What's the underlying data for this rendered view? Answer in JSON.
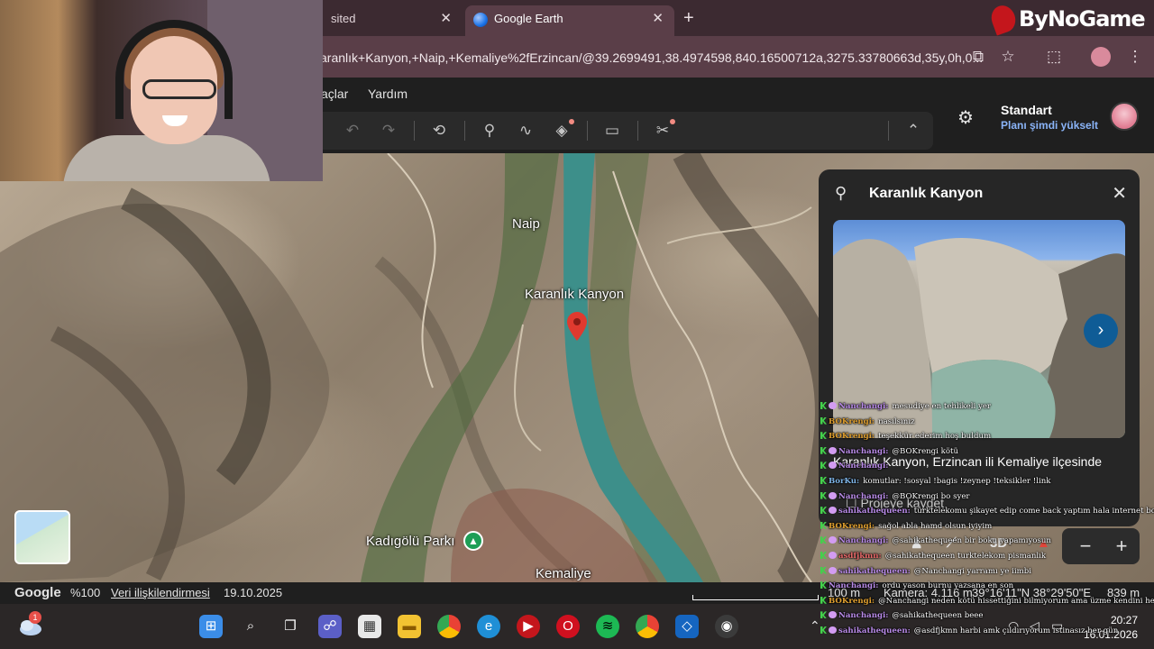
{
  "browser": {
    "tabs": [
      {
        "label": "sited",
        "close": "✕"
      },
      {
        "label": "Google Earth",
        "close": "✕"
      }
    ],
    "new_tab": "+",
    "url": "aranlık+Kanyon,+Naip,+Kemaliye%2fErzincan/@39.2699491,38.4974598,840.16500712a,3275.33780663d,35y,0h,0..."
  },
  "brand": {
    "text": "ByNoGame"
  },
  "app": {
    "menu": [
      "açlar",
      "Yardım"
    ],
    "plan_title": "Standart",
    "plan_link": "Planı şimdi yükselt"
  },
  "map": {
    "labels": {
      "naip": "Naip",
      "karanlik": "Karanlık Kanyon",
      "park": "Kadıgölü Parkı",
      "kemaliye": "Kemaliye"
    }
  },
  "panel": {
    "title": "Karanlık Kanyon",
    "description": "Karanlık Kanyon, Erzincan ili Kemaliye ilçesinde",
    "save_label": "Projeye kaydet",
    "mode_3d": "3D",
    "zoom_out": "−",
    "zoom_in": "+"
  },
  "status": {
    "google": "Google",
    "zoom": "%100",
    "data_link": "Veri ilişkilendirmesi",
    "date": "19.10.2025",
    "scale": "100 m",
    "camera": "Kamera: 4.116 m",
    "coords": "39°16'11\"N 38°29'50\"E",
    "elevation": "839 m"
  },
  "chat": [
    {
      "user": "Nanchangi:",
      "msg": "mesudiye en tehlikeli yer",
      "color": "#b98be8",
      "heart": true
    },
    {
      "user": "BOKrengi:",
      "msg": "nasılsınız",
      "color": "#e0a030",
      "heart": false
    },
    {
      "user": "BOKrengi:",
      "msg": "teşekkür ederim hoş buldum",
      "color": "#e0a030",
      "heart": false
    },
    {
      "user": "Nanchangi:",
      "msg": "@BOKrengi kötü",
      "color": "#b98be8",
      "heart": true
    },
    {
      "user": "Nanchangi:",
      "msg": "",
      "color": "#b98be8",
      "heart": true
    },
    {
      "user": "BorKu:",
      "msg": "komutlar: !sosyal !bagis !zeynep !teksikler !link",
      "color": "#7fb5e8",
      "heart": false
    },
    {
      "user": "Nanchangi:",
      "msg": "@BOKrengi bo syer",
      "color": "#b98be8",
      "heart": true
    },
    {
      "user": "sahikathequeen:",
      "msg": "türktelekomu şikayet edip come back yaptım hala internet bok gibi",
      "color": "#b98be8",
      "heart": true
    },
    {
      "user": "BOKrengi:",
      "msg": "sağol abla hamd olsun iyiyim",
      "color": "#e0a030",
      "heart": false
    },
    {
      "user": "Nanchangi:",
      "msg": "@sahikathequeen bir boku yapamıyosun",
      "color": "#b98be8",
      "heart": true
    },
    {
      "user": "asdfjkmn:",
      "msg": "@sahikathequeen turktelekom pismanlık",
      "color": "#e86a6a",
      "heart": true
    },
    {
      "user": "sahikathequeen:",
      "msg": "@Nanchangi yarramı ye iimbi",
      "color": "#b98be8",
      "heart": true
    },
    {
      "user": "Nanchangi:",
      "msg": "ordu yason burnu yazsana en son",
      "color": "#b98be8",
      "heart": false
    },
    {
      "user": "BOKrengi:",
      "msg": "@Nanchangi neden kötü hissettiğini bilmiyorum ama üzme kendini herşey zamanla yoluna girecektir su akar yolunu bulur",
      "color": "#e0a030",
      "heart": false
    },
    {
      "user": "Nanchangi:",
      "msg": "@sahikathequeen beee",
      "color": "#b98be8",
      "heart": true
    },
    {
      "user": "sahikathequeen:",
      "msg": "@asdfjkmn harbi amk çıldırıyorum istinasız her gün",
      "color": "#b98be8",
      "heart": true
    }
  ],
  "taskbar": {
    "notification_count": "1",
    "time": "20:27",
    "date": "16.01.2026"
  }
}
